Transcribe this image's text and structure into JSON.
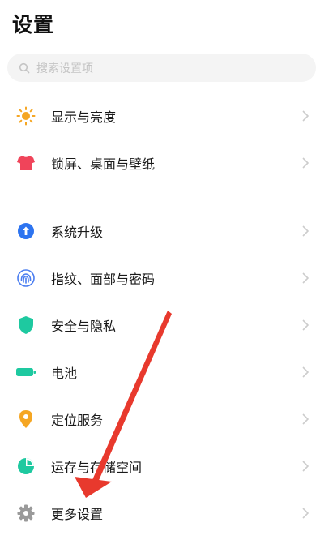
{
  "header": {
    "title": "设置"
  },
  "search": {
    "placeholder": "搜索设置项"
  },
  "settings": [
    {
      "label": "显示与亮度",
      "icon": "sun-icon",
      "color": "#f5a623"
    },
    {
      "label": "锁屏、桌面与壁纸",
      "icon": "tshirt-icon",
      "color": "#f0445a"
    },
    {
      "label": "系统升级",
      "icon": "upgrade-icon",
      "color": "#2d74f0"
    },
    {
      "label": "指纹、面部与密码",
      "icon": "fingerprint-icon",
      "color": "#4a7df0"
    },
    {
      "label": "安全与隐私",
      "icon": "shield-icon",
      "color": "#1ec9a0"
    },
    {
      "label": "电池",
      "icon": "battery-icon",
      "color": "#1ec9a0"
    },
    {
      "label": "定位服务",
      "icon": "location-icon",
      "color": "#f5a623"
    },
    {
      "label": "运存与存储空间",
      "icon": "storage-pie-icon",
      "color": "#1ec9a0"
    },
    {
      "label": "更多设置",
      "icon": "gear-icon",
      "color": "#9a9a9a"
    }
  ],
  "overlay": {
    "arrow_color": "#e8392d"
  }
}
